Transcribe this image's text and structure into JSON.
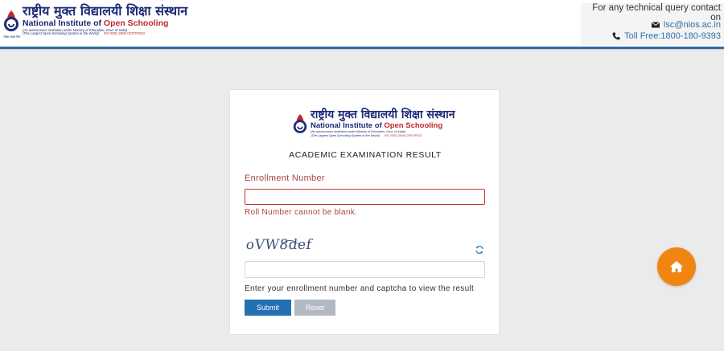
{
  "brand": {
    "hindi_name": "राष्ट्रीय मुक्त विद्यालयी शिक्षा संस्थान",
    "name_part1": "National Institute of ",
    "name_part2": "Open Schooling",
    "subtitle_1": "(An autonomous institution under Ministry of Education, Govt. of India)",
    "subtitle_2": "(The Largest Open Schooling System in the World)",
    "certification": "ISO 9001:2008 CERTIFIED",
    "emblem_text": "शिक्षा सबके लिए",
    "brand_blue": "#1b2a78",
    "brand_red": "#c0282d"
  },
  "contact": {
    "heading": "For any technical query contact on",
    "email": "lsc@nios.ac.in",
    "phone": "Toll Free:1800-180-9393"
  },
  "form": {
    "title": "ACADEMIC EXAMINATION RESULT",
    "enrollment_label": "Enrollment Number",
    "enrollment_value": "",
    "enrollment_placeholder": "",
    "enrollment_error": "Roll Number cannot be blank.",
    "captcha_text": "oVW8def",
    "captcha_value": "",
    "hint": "Enter your enrollment number and captcha to view the result",
    "submit_label": "Submit",
    "reset_label": "Reset"
  },
  "colors": {
    "accent": "#2d6ea8",
    "error": "#a94442",
    "submit": "#2470b3",
    "reset": "#b2b9c2",
    "home": "#f0850f"
  },
  "icons": {
    "email": "envelope-icon",
    "phone": "phone-icon",
    "refresh": "refresh-icon",
    "home": "home-icon"
  }
}
